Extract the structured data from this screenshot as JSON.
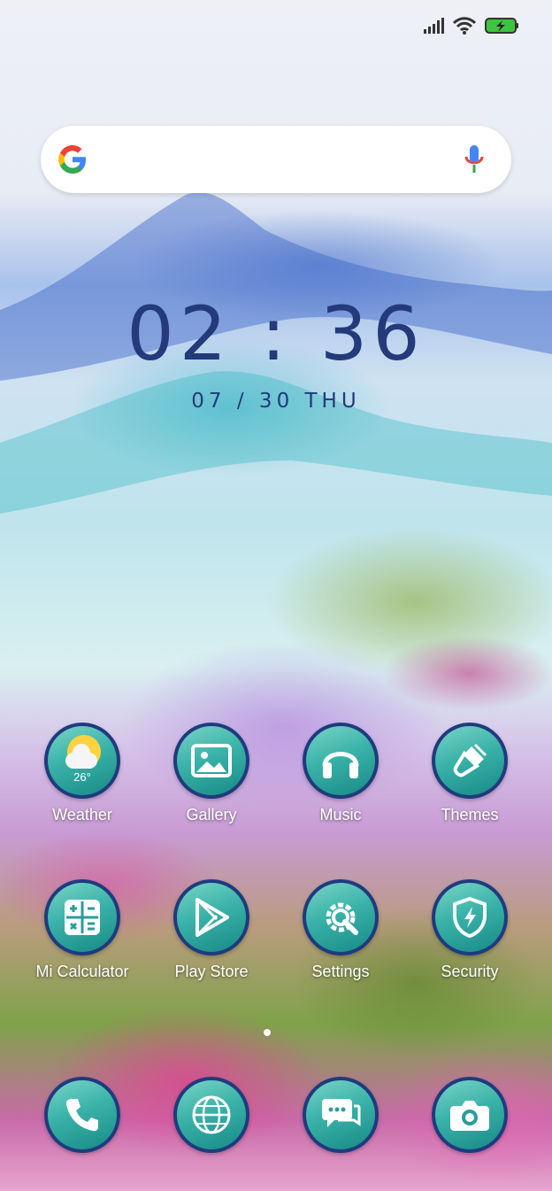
{
  "status_bar": {
    "signal_icon": "cellular-signal-icon",
    "wifi_icon": "wifi-icon",
    "battery_icon": "battery-charging-icon",
    "battery_color": "#3ec43e"
  },
  "search": {
    "logo_icon": "google-logo-icon",
    "mic_icon": "microphone-icon",
    "placeholder": ""
  },
  "clock": {
    "time": "02 : 36",
    "date": "07 / 30  THU"
  },
  "apps": [
    {
      "label": "Weather",
      "icon": "weather-icon",
      "temp": "26°"
    },
    {
      "label": "Gallery",
      "icon": "gallery-icon"
    },
    {
      "label": "Music",
      "icon": "headphones-icon"
    },
    {
      "label": "Themes",
      "icon": "paintbrush-icon"
    },
    {
      "label": "Mi Calculator",
      "icon": "calculator-icon"
    },
    {
      "label": "Play Store",
      "icon": "play-store-icon"
    },
    {
      "label": "Settings",
      "icon": "settings-gear-icon"
    },
    {
      "label": "Security",
      "icon": "security-shield-icon"
    }
  ],
  "dock": [
    {
      "icon": "phone-icon"
    },
    {
      "icon": "browser-globe-icon"
    },
    {
      "icon": "messages-icon"
    },
    {
      "icon": "camera-icon"
    }
  ],
  "colors": {
    "icon_border": "#1f3b7e",
    "icon_fill": "#3ab2a8",
    "clock_text": "#243a7a"
  }
}
